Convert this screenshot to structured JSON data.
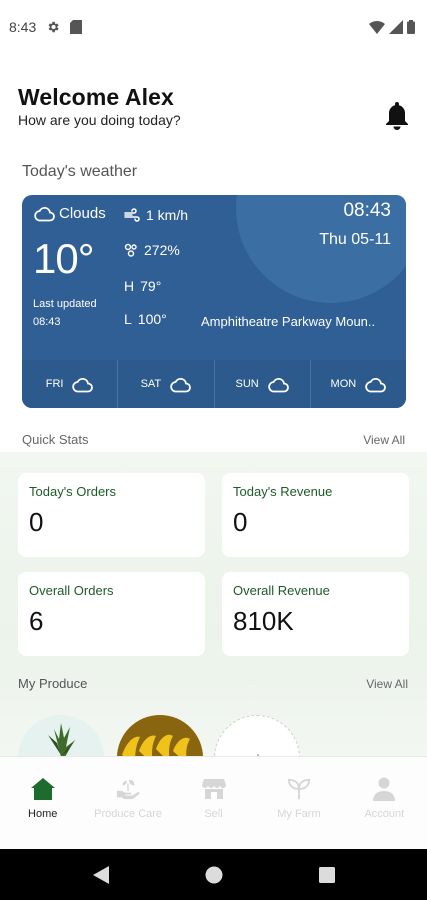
{
  "status": {
    "time": "8:43"
  },
  "header": {
    "welcome": "Welcome Alex",
    "subtitle": "How are you doing today?"
  },
  "weather": {
    "section_title": "Today's weather",
    "condition": "Clouds",
    "temperature": "10°",
    "last_updated_label": "Last updated",
    "last_updated_time": "08:43",
    "wind": "1 km/h",
    "humidity": "272%",
    "high": "79°",
    "low": "100°",
    "high_label": "H",
    "low_label": "L",
    "time": "08:43",
    "date": "Thu 05-11",
    "location": "Amphitheatre Parkway Moun..",
    "forecast": [
      {
        "day": "FRI"
      },
      {
        "day": "SAT"
      },
      {
        "day": "SUN"
      },
      {
        "day": "MON"
      }
    ]
  },
  "quick_stats": {
    "title": "Quick Stats",
    "view_all": "View All",
    "cards": [
      {
        "label": "Today's Orders",
        "value": "0"
      },
      {
        "label": "Today's Revenue",
        "value": "0"
      },
      {
        "label": "Overall Orders",
        "value": "6"
      },
      {
        "label": "Overall Revenue",
        "value": "810K"
      }
    ]
  },
  "produce": {
    "title": "My Produce",
    "view_all": "View All"
  },
  "nav": [
    {
      "label": "Home",
      "icon": "home-icon"
    },
    {
      "label": "Produce Care",
      "icon": "produce-care-icon"
    },
    {
      "label": "Sell",
      "icon": "store-icon"
    },
    {
      "label": "My Farm",
      "icon": "sprout-icon"
    },
    {
      "label": "Account",
      "icon": "person-icon"
    }
  ],
  "colors": {
    "weather_card": "#2f5f94",
    "active_nav": "#1e6b2e",
    "stat_label": "#1e5a2a"
  }
}
